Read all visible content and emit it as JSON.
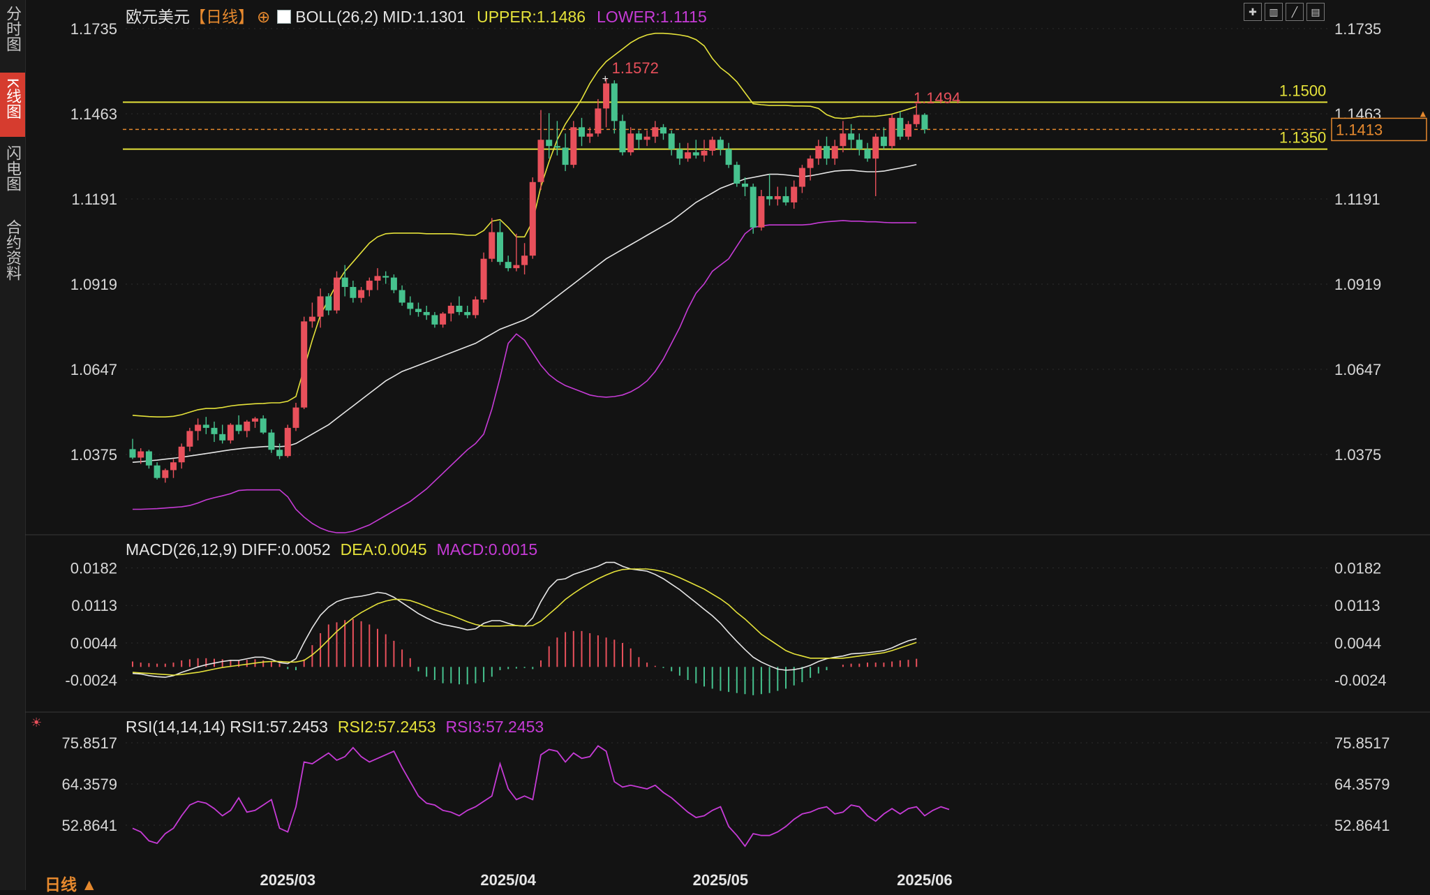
{
  "sidebar": {
    "tabs": [
      {
        "label": "分时图",
        "active": false
      },
      {
        "label": "K线图",
        "active": true
      },
      {
        "label": "闪电图",
        "active": false
      },
      {
        "label": "合约资料",
        "active": false
      }
    ]
  },
  "header": {
    "symbol": "欧元美元",
    "period_tag": "【日线】",
    "boll_label": "BOLL(26,2)",
    "mid": "MID:1.1301",
    "upper": "UPPER:1.1486",
    "lower": "LOWER:1.1115"
  },
  "colors": {
    "up": "#e8505b",
    "down": "#46c28e",
    "boll_upper": "#e5e23a",
    "boll_mid": "#e6e6e6",
    "boll_lower": "#c63bd6",
    "axis_text": "#d8d8d8",
    "price_line": "#e6892e"
  },
  "price_axis": {
    "ticks": [
      "1.1735",
      "1.1463",
      "1.1191",
      "1.0919",
      "1.0647",
      "1.0375"
    ],
    "current_price": "1.1413"
  },
  "annotations": {
    "high_label": "1.1572",
    "recent_high_label": "1.1494",
    "level_upper": "1.1500",
    "level_lower": "1.1350"
  },
  "macd_panel": {
    "label": "MACD(26,12,9)",
    "diff": "DIFF:0.0052",
    "dea": "DEA:0.0045",
    "macd": "MACD:0.0015",
    "ticks": [
      "0.0182",
      "0.0113",
      "0.0044",
      "-0.0024"
    ]
  },
  "rsi_panel": {
    "label": "RSI(14,14,14)",
    "rsi1": "RSI1:57.2453",
    "rsi2": "RSI2:57.2453",
    "rsi3": "RSI3:57.2453",
    "ticks": [
      "75.8517",
      "64.3579",
      "52.8641"
    ]
  },
  "x_axis": {
    "labels": [
      "2025/03",
      "2025/04",
      "2025/05",
      "2025/06"
    ]
  },
  "footer": {
    "period": "日线 ▲"
  },
  "chart_data": {
    "type": "candlestick",
    "ohlc": [
      [
        1.0392,
        1.0425,
        1.036,
        1.0365
      ],
      [
        1.0365,
        1.0395,
        1.0345,
        1.0385
      ],
      [
        1.0385,
        1.039,
        1.033,
        1.034
      ],
      [
        1.034,
        1.035,
        1.0295,
        1.03
      ],
      [
        1.03,
        1.033,
        1.0285,
        1.0325
      ],
      [
        1.0325,
        1.036,
        1.03,
        1.035
      ],
      [
        1.035,
        1.041,
        1.033,
        1.04
      ],
      [
        1.04,
        1.046,
        1.0385,
        1.045
      ],
      [
        1.045,
        1.049,
        1.042,
        1.047
      ],
      [
        1.047,
        1.0495,
        1.044,
        1.046
      ],
      [
        1.046,
        1.048,
        1.0415,
        1.044
      ],
      [
        1.044,
        1.047,
        1.041,
        1.042
      ],
      [
        1.042,
        1.0475,
        1.041,
        1.047
      ],
      [
        1.047,
        1.05,
        1.044,
        1.045
      ],
      [
        1.045,
        1.0485,
        1.043,
        1.048
      ],
      [
        1.048,
        1.0495,
        1.046,
        1.049
      ],
      [
        1.049,
        1.05,
        1.044,
        1.0445
      ],
      [
        1.0445,
        1.0455,
        1.038,
        1.039
      ],
      [
        1.039,
        1.041,
        1.036,
        1.037
      ],
      [
        1.037,
        1.047,
        1.0365,
        1.046
      ],
      [
        1.046,
        1.054,
        1.045,
        1.0525
      ],
      [
        1.0525,
        1.0815,
        1.052,
        1.08
      ],
      [
        1.08,
        1.086,
        1.078,
        1.0815
      ],
      [
        1.0815,
        1.0905,
        1.078,
        1.088
      ],
      [
        1.088,
        1.089,
        1.082,
        1.0835
      ],
      [
        1.0835,
        1.096,
        1.0825,
        1.094
      ],
      [
        1.094,
        1.098,
        1.088,
        1.091
      ],
      [
        1.091,
        1.093,
        1.086,
        1.0875
      ],
      [
        1.0875,
        1.091,
        1.086,
        1.09
      ],
      [
        1.09,
        1.094,
        1.088,
        1.093
      ],
      [
        1.093,
        1.097,
        1.09,
        1.0945
      ],
      [
        1.0945,
        1.096,
        1.092,
        1.094
      ],
      [
        1.094,
        1.095,
        1.089,
        1.09
      ],
      [
        1.09,
        1.0915,
        1.085,
        1.086
      ],
      [
        1.086,
        1.088,
        1.082,
        1.084
      ],
      [
        1.084,
        1.086,
        1.0815,
        1.083
      ],
      [
        1.083,
        1.085,
        1.0805,
        1.082
      ],
      [
        1.082,
        1.083,
        1.078,
        1.079
      ],
      [
        1.079,
        1.083,
        1.078,
        1.0825
      ],
      [
        1.0825,
        1.086,
        1.08,
        1.085
      ],
      [
        1.085,
        1.088,
        1.082,
        1.083
      ],
      [
        1.083,
        1.085,
        1.081,
        1.082
      ],
      [
        1.082,
        1.088,
        1.081,
        1.087
      ],
      [
        1.087,
        1.102,
        1.086,
        1.1
      ],
      [
        1.1,
        1.113,
        1.099,
        1.1085
      ],
      [
        1.1085,
        1.112,
        1.098,
        1.099
      ],
      [
        1.099,
        1.101,
        1.096,
        1.097
      ],
      [
        1.097,
        1.108,
        1.096,
        1.098
      ],
      [
        1.098,
        1.105,
        1.095,
        1.101
      ],
      [
        1.101,
        1.126,
        1.1,
        1.1245
      ],
      [
        1.1245,
        1.1475,
        1.122,
        1.138
      ],
      [
        1.138,
        1.1465,
        1.132,
        1.136
      ],
      [
        1.136,
        1.144,
        1.133,
        1.1355
      ],
      [
        1.1355,
        1.14,
        1.128,
        1.13
      ],
      [
        1.13,
        1.144,
        1.129,
        1.142
      ],
      [
        1.142,
        1.145,
        1.136,
        1.139
      ],
      [
        1.139,
        1.142,
        1.137,
        1.14
      ],
      [
        1.14,
        1.151,
        1.139,
        1.148
      ],
      [
        1.148,
        1.1575,
        1.142,
        1.156
      ],
      [
        1.156,
        1.157,
        1.14,
        1.144
      ],
      [
        1.144,
        1.146,
        1.133,
        1.134
      ],
      [
        1.134,
        1.142,
        1.133,
        1.14
      ],
      [
        1.14,
        1.141,
        1.135,
        1.138
      ],
      [
        1.138,
        1.141,
        1.136,
        1.139
      ],
      [
        1.139,
        1.144,
        1.137,
        1.142
      ],
      [
        1.142,
        1.143,
        1.138,
        1.14
      ],
      [
        1.14,
        1.141,
        1.133,
        1.135
      ],
      [
        1.135,
        1.137,
        1.13,
        1.132
      ],
      [
        1.132,
        1.137,
        1.131,
        1.134
      ],
      [
        1.134,
        1.138,
        1.132,
        1.133
      ],
      [
        1.133,
        1.138,
        1.131,
        1.1345
      ],
      [
        1.1345,
        1.139,
        1.133,
        1.138
      ],
      [
        1.138,
        1.139,
        1.133,
        1.135
      ],
      [
        1.135,
        1.137,
        1.129,
        1.13
      ],
      [
        1.13,
        1.131,
        1.123,
        1.124
      ],
      [
        1.124,
        1.126,
        1.12,
        1.123
      ],
      [
        1.123,
        1.124,
        1.108,
        1.11
      ],
      [
        1.11,
        1.122,
        1.109,
        1.12
      ],
      [
        1.12,
        1.127,
        1.117,
        1.119
      ],
      [
        1.119,
        1.123,
        1.117,
        1.12
      ],
      [
        1.12,
        1.123,
        1.117,
        1.118
      ],
      [
        1.118,
        1.125,
        1.116,
        1.123
      ],
      [
        1.123,
        1.13,
        1.121,
        1.129
      ],
      [
        1.129,
        1.133,
        1.125,
        1.132
      ],
      [
        1.132,
        1.138,
        1.13,
        1.136
      ],
      [
        1.136,
        1.139,
        1.13,
        1.132
      ],
      [
        1.132,
        1.138,
        1.13,
        1.136
      ],
      [
        1.136,
        1.144,
        1.134,
        1.14
      ],
      [
        1.14,
        1.143,
        1.135,
        1.138
      ],
      [
        1.138,
        1.14,
        1.133,
        1.135
      ],
      [
        1.135,
        1.137,
        1.131,
        1.132
      ],
      [
        1.132,
        1.14,
        1.12,
        1.139
      ],
      [
        1.139,
        1.142,
        1.135,
        1.136
      ],
      [
        1.136,
        1.146,
        1.135,
        1.145
      ],
      [
        1.145,
        1.147,
        1.138,
        1.139
      ],
      [
        1.139,
        1.144,
        1.138,
        1.143
      ],
      [
        1.143,
        1.1495,
        1.142,
        1.146
      ],
      [
        1.146,
        1.1465,
        1.14,
        1.1413
      ]
    ],
    "boll_upper": [
      1.05,
      1.0498,
      1.0496,
      1.0495,
      1.0495,
      1.0497,
      1.0502,
      1.051,
      1.0518,
      1.0522,
      1.0522,
      1.0525,
      1.053,
      1.0533,
      1.0535,
      1.0537,
      1.0538,
      1.054,
      1.054,
      1.0545,
      1.056,
      1.065,
      1.074,
      1.082,
      1.087,
      1.092,
      1.096,
      1.099,
      1.102,
      1.105,
      1.107,
      1.108,
      1.1082,
      1.1082,
      1.1082,
      1.1082,
      1.108,
      1.108,
      1.108,
      1.108,
      1.1078,
      1.1075,
      1.1075,
      1.109,
      1.112,
      1.1125,
      1.11,
      1.107,
      1.107,
      1.112,
      1.123,
      1.131,
      1.138,
      1.143,
      1.147,
      1.151,
      1.156,
      1.16,
      1.163,
      1.165,
      1.167,
      1.169,
      1.1705,
      1.1715,
      1.172,
      1.172,
      1.1718,
      1.1715,
      1.171,
      1.17,
      1.168,
      1.164,
      1.161,
      1.159,
      1.1565,
      1.153,
      1.1495,
      1.1492,
      1.149,
      1.149,
      1.149,
      1.1488,
      1.1488,
      1.1487,
      1.148,
      1.146,
      1.145,
      1.1448,
      1.145,
      1.1455,
      1.1455,
      1.1455,
      1.1458,
      1.1462,
      1.147,
      1.1478,
      1.1486
    ],
    "boll_mid": [
      1.035,
      1.0352,
      1.0355,
      1.0357,
      1.036,
      1.0363,
      1.0366,
      1.037,
      1.0374,
      1.0378,
      1.0382,
      1.0386,
      1.039,
      1.0393,
      1.0396,
      1.0398,
      1.04,
      1.0401,
      1.04,
      1.0402,
      1.041,
      1.0425,
      1.044,
      1.0455,
      1.047,
      1.049,
      1.051,
      1.053,
      1.055,
      1.057,
      1.059,
      1.061,
      1.0625,
      1.064,
      1.065,
      1.066,
      1.067,
      1.068,
      1.069,
      1.07,
      1.071,
      1.072,
      1.073,
      1.0745,
      1.076,
      1.0775,
      1.0785,
      1.0795,
      1.0805,
      1.082,
      1.084,
      1.086,
      1.088,
      1.09,
      1.092,
      1.094,
      1.096,
      1.098,
      1.1,
      1.1015,
      1.103,
      1.1045,
      1.106,
      1.1075,
      1.109,
      1.1105,
      1.112,
      1.114,
      1.116,
      1.118,
      1.1195,
      1.121,
      1.1225,
      1.1235,
      1.1245,
      1.1255,
      1.126,
      1.1265,
      1.127,
      1.127,
      1.1268,
      1.1265,
      1.1262,
      1.1265,
      1.127,
      1.1275,
      1.128,
      1.1282,
      1.1283,
      1.128,
      1.1278,
      1.1278,
      1.128,
      1.1285,
      1.129,
      1.1295,
      1.1301
    ],
    "boll_lower": [
      1.02,
      1.02,
      1.0201,
      1.0202,
      1.0204,
      1.0206,
      1.0208,
      1.0212,
      1.022,
      1.023,
      1.0237,
      1.0243,
      1.025,
      1.026,
      1.0262,
      1.0262,
      1.0262,
      1.0262,
      1.0262,
      1.024,
      1.02,
      1.0175,
      1.0155,
      1.014,
      1.013,
      1.0125,
      1.0125,
      1.013,
      1.014,
      1.015,
      1.0165,
      1.018,
      1.0195,
      1.021,
      1.0225,
      1.0245,
      1.0265,
      1.029,
      1.0315,
      1.034,
      1.0365,
      1.039,
      1.041,
      1.044,
      1.052,
      1.062,
      1.073,
      1.076,
      1.074,
      1.07,
      1.066,
      1.063,
      1.061,
      1.0595,
      1.0585,
      1.0575,
      1.0565,
      1.056,
      1.0558,
      1.056,
      1.0565,
      1.0575,
      1.059,
      1.061,
      1.064,
      1.068,
      1.073,
      1.078,
      1.084,
      1.089,
      1.092,
      1.096,
      1.098,
      1.1,
      1.104,
      1.108,
      1.11,
      1.1105,
      1.1108,
      1.1108,
      1.1108,
      1.1108,
      1.1108,
      1.111,
      1.1115,
      1.1118,
      1.112,
      1.1122,
      1.112,
      1.112,
      1.1118,
      1.1118,
      1.1116,
      1.1115,
      1.1115,
      1.1115,
      1.1115
    ],
    "macd_diff": [
      -0.0012,
      -0.0013,
      -0.0016,
      -0.0018,
      -0.0019,
      -0.0016,
      -0.001,
      -0.0005,
      0.0,
      0.0004,
      0.0007,
      0.001,
      0.0012,
      0.0012,
      0.0015,
      0.0018,
      0.0018,
      0.0014,
      0.0008,
      0.0006,
      0.0015,
      0.0045,
      0.0072,
      0.0095,
      0.011,
      0.012,
      0.0125,
      0.0128,
      0.013,
      0.0133,
      0.0137,
      0.0135,
      0.0128,
      0.0118,
      0.0108,
      0.0098,
      0.009,
      0.0083,
      0.0078,
      0.0075,
      0.0072,
      0.0068,
      0.007,
      0.008,
      0.0085,
      0.0085,
      0.008,
      0.0076,
      0.0075,
      0.009,
      0.012,
      0.0145,
      0.016,
      0.0162,
      0.017,
      0.0175,
      0.018,
      0.0185,
      0.0192,
      0.0192,
      0.0185,
      0.018,
      0.0178,
      0.0176,
      0.017,
      0.0162,
      0.0152,
      0.0142,
      0.013,
      0.0118,
      0.0106,
      0.0094,
      0.008,
      0.0063,
      0.0047,
      0.0032,
      0.0018,
      0.0009,
      0.0002,
      -0.0004,
      -0.0006,
      -0.0005,
      -0.0002,
      0.0003,
      0.001,
      0.0015,
      0.0018,
      0.002,
      0.0024,
      0.0025,
      0.0026,
      0.0028,
      0.003,
      0.0035,
      0.0042,
      0.0048,
      0.0052
    ],
    "macd_dea": [
      -0.001,
      -0.0011,
      -0.0012,
      -0.0013,
      -0.0014,
      -0.0015,
      -0.0014,
      -0.0012,
      -0.001,
      -0.0007,
      -0.0004,
      -0.0001,
      0.0001,
      0.0003,
      0.0005,
      0.0007,
      0.0009,
      0.001,
      0.001,
      0.0009,
      0.0009,
      0.0012,
      0.0022,
      0.0035,
      0.005,
      0.0065,
      0.0078,
      0.009,
      0.01,
      0.0108,
      0.0116,
      0.0121,
      0.0124,
      0.0124,
      0.0122,
      0.0117,
      0.0111,
      0.0105,
      0.01,
      0.0095,
      0.0089,
      0.0083,
      0.0078,
      0.0075,
      0.0075,
      0.0075,
      0.0076,
      0.0076,
      0.0075,
      0.0076,
      0.0084,
      0.0097,
      0.011,
      0.0124,
      0.0135,
      0.0145,
      0.0154,
      0.0162,
      0.0169,
      0.0175,
      0.0179,
      0.018,
      0.018,
      0.018,
      0.0178,
      0.0175,
      0.017,
      0.0164,
      0.0157,
      0.015,
      0.0143,
      0.0134,
      0.0125,
      0.0114,
      0.01,
      0.0088,
      0.0074,
      0.006,
      0.005,
      0.004,
      0.003,
      0.0024,
      0.002,
      0.0016,
      0.0016,
      0.0016,
      0.0016,
      0.0016,
      0.0018,
      0.002,
      0.0022,
      0.0024,
      0.0026,
      0.003,
      0.0035,
      0.004,
      0.0045
    ],
    "macd_hist": [
      0.001,
      0.0008,
      0.0007,
      0.0006,
      0.0006,
      0.0008,
      0.0012,
      0.0014,
      0.0016,
      0.0016,
      0.0015,
      0.0014,
      0.0013,
      0.0012,
      0.0013,
      0.0014,
      0.0012,
      0.001,
      0.0006,
      -0.0004,
      -0.0006,
      0.0014,
      0.004,
      0.0062,
      0.0078,
      0.0082,
      0.0086,
      0.0088,
      0.0084,
      0.0078,
      0.007,
      0.006,
      0.0048,
      0.0032,
      0.0016,
      -0.0008,
      -0.0018,
      -0.0024,
      -0.003,
      -0.003,
      -0.0032,
      -0.0032,
      -0.003,
      -0.0028,
      -0.0018,
      -0.0006,
      -0.0004,
      -0.0003,
      -0.0002,
      -0.0004,
      0.0012,
      0.0038,
      0.0054,
      0.0064,
      0.0066,
      0.0066,
      0.0062,
      0.0058,
      0.0054,
      0.005,
      0.0044,
      0.0034,
      0.0018,
      0.0008,
      0.0002,
      -0.0002,
      -0.0008,
      -0.0016,
      -0.0024,
      -0.003,
      -0.0036,
      -0.004,
      -0.0044,
      -0.0046,
      -0.0048,
      -0.005,
      -0.0052,
      -0.005,
      -0.0048,
      -0.0044,
      -0.004,
      -0.0034,
      -0.0028,
      -0.002,
      -0.0012,
      -0.0006,
      0.0,
      0.0004,
      0.0006,
      0.0006,
      0.0008,
      0.0008,
      0.0008,
      0.001,
      0.0012,
      0.0013,
      0.0015
    ],
    "rsi": [
      52.0,
      51.0,
      48.5,
      47.8,
      50.5,
      52.0,
      55.5,
      58.5,
      59.5,
      59.0,
      57.5,
      55.5,
      57.0,
      60.5,
      56.5,
      57.0,
      58.5,
      60.0,
      52.0,
      51.0,
      58.0,
      70.5,
      70.0,
      71.5,
      73.0,
      71.0,
      72.0,
      74.5,
      72.0,
      70.5,
      71.5,
      72.5,
      73.5,
      69.0,
      65.0,
      61.0,
      59.0,
      58.5,
      57.0,
      56.5,
      55.5,
      57.0,
      58.0,
      59.5,
      61.0,
      70.0,
      63.0,
      60.0,
      61.0,
      60.0,
      72.5,
      74.0,
      73.5,
      70.5,
      73.0,
      71.5,
      72.0,
      75.0,
      73.5,
      65.0,
      63.5,
      64.0,
      63.5,
      63.0,
      64.0,
      62.0,
      60.5,
      58.5,
      56.5,
      55.0,
      55.5,
      57.0,
      58.0,
      52.5,
      50.0,
      47.0,
      50.5,
      50.0,
      50.0,
      51.0,
      52.5,
      54.5,
      56.0,
      56.5,
      57.5,
      58.0,
      56.0,
      56.5,
      58.5,
      58.0,
      55.5,
      54.0,
      56.0,
      57.5,
      56.0,
      57.5,
      58.0,
      55.5,
      57.0,
      58.0,
      57.2453
    ]
  }
}
